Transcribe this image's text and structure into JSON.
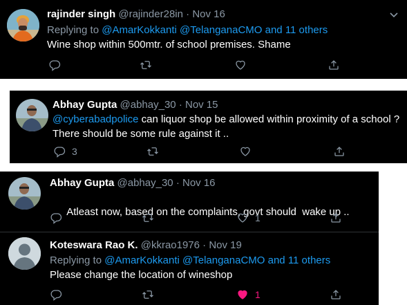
{
  "tweets": [
    {
      "name": "rajinder singh",
      "handle": "@rajinder28in",
      "date": "Nov 16",
      "replying_prefix": "Replying to",
      "reply_mentions": [
        "@AmarKokkanti",
        "@TelanganaCMO"
      ],
      "reply_others": "and 11 others",
      "text": "Wine shop within 500mtr. of school premises. Shame"
    },
    {
      "name": "Abhay Gupta",
      "handle": "@abhay_30",
      "date": "Nov 15",
      "text_mention": "@cyberabadpolice",
      "text": " can liquor shop be allowed within proximity of a school ?",
      "text_line2": "There should be some rule against it ..",
      "reply_count": "3"
    },
    {
      "name": "Abhay Gupta",
      "handle": "@abhay_30",
      "date": "Nov 16",
      "text": "Atleast now, based on the complaints, govt should  wake up ..",
      "like_count": "1"
    },
    {
      "name": "Koteswara Rao K.",
      "handle": "@kkrao1976",
      "date": "Nov 19",
      "replying_prefix": "Replying to",
      "reply_mentions": [
        "@AmarKokkanti",
        "@TelanganaCMO"
      ],
      "reply_others": "and 11 others",
      "text": "Please change the location of wineshop",
      "like_count": "1",
      "liked": true
    }
  ],
  "separator": "·",
  "icons": [
    "reply-icon",
    "retweet-icon",
    "like-icon",
    "share-icon",
    "more-chevron-icon"
  ],
  "colors": {
    "background": "#000000",
    "name": "#ffffff",
    "muted": "#8b98a5",
    "link": "#1d9bf0",
    "liked": "#f91880"
  }
}
